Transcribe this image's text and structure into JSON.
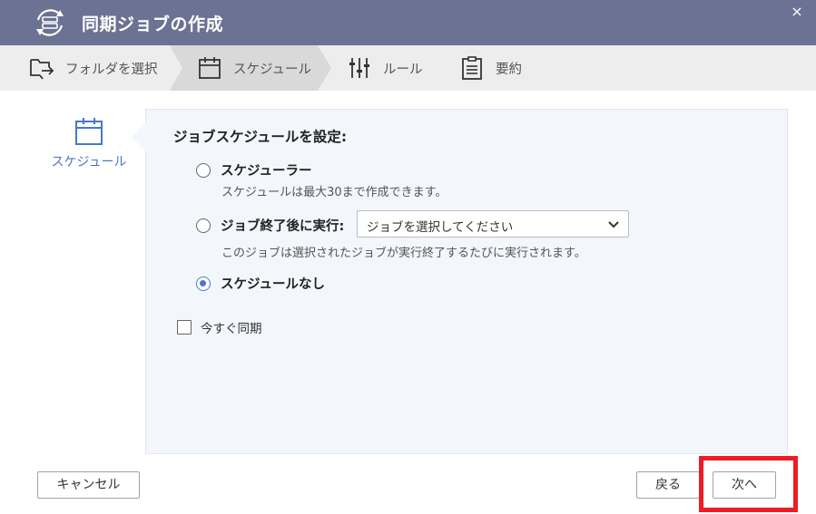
{
  "window": {
    "title": "同期ジョブの作成",
    "close_glyph": "×"
  },
  "steps": [
    {
      "label": "フォルダを選択",
      "icon": "folder-select-icon",
      "active": false
    },
    {
      "label": "スケジュール",
      "icon": "calendar-icon",
      "active": true
    },
    {
      "label": "ルール",
      "icon": "sliders-icon",
      "active": false
    },
    {
      "label": "要約",
      "icon": "clipboard-icon",
      "active": false
    }
  ],
  "sidebar": {
    "items": [
      {
        "label": "スケジュール",
        "icon": "calendar-icon",
        "active": true
      }
    ]
  },
  "main": {
    "heading": "ジョブスケジュールを設定:",
    "options": [
      {
        "label": "スケジューラー",
        "hint": "スケジュールは最大30まで作成できます。",
        "checked": false
      },
      {
        "label": "ジョブ終了後に実行:",
        "hint": "このジョブは選択されたジョブが実行終了するたびに実行されます。",
        "checked": false
      },
      {
        "label": "スケジュールなし",
        "checked": true
      }
    ],
    "job_select": {
      "value": "ジョブを選択してください"
    },
    "sync_now": {
      "label": "今すぐ同期",
      "checked": false
    }
  },
  "footer": {
    "cancel_label": "キャンセル",
    "back_label": "戻る",
    "next_label": "次へ"
  },
  "colors": {
    "titlebar": "#6c7293",
    "accent": "#4a78d0",
    "highlight": "#ee1c24"
  }
}
